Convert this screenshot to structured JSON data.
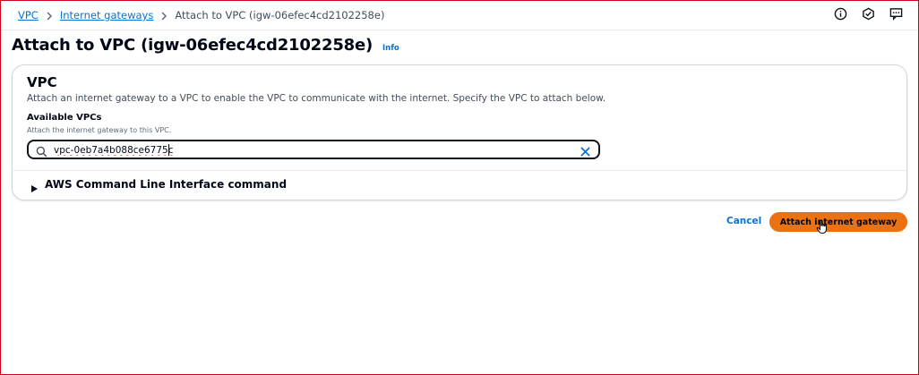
{
  "breadcrumb": {
    "items": [
      {
        "label": "VPC"
      },
      {
        "label": "Internet gateways"
      },
      {
        "label": "Attach to VPC (igw-06efec4cd2102258e)"
      }
    ]
  },
  "top_icons": [
    "info-circle-icon",
    "notifications-icon",
    "feedback-icon"
  ],
  "header": {
    "title": "Attach to VPC (igw-06efec4cd2102258e)",
    "info_label": "Info"
  },
  "vpc_section": {
    "title": "VPC",
    "description": "Attach an internet gateway to a VPC to enable the VPC to communicate with the internet. Specify the VPC to attach below.",
    "field": {
      "label": "Available VPCs",
      "description": "Attach the internet gateway to this VPC.",
      "value": "vpc-0eb7a4b088ce6775c",
      "placeholder": ""
    },
    "expander_label": "AWS Command Line Interface command"
  },
  "actions": {
    "cancel_label": "Cancel",
    "attach_label": "Attach internet gateway"
  },
  "colors": {
    "link": "#0972d3",
    "primary_button": "#ec7211",
    "text": "#000716",
    "frame_border": "#d0021b"
  }
}
